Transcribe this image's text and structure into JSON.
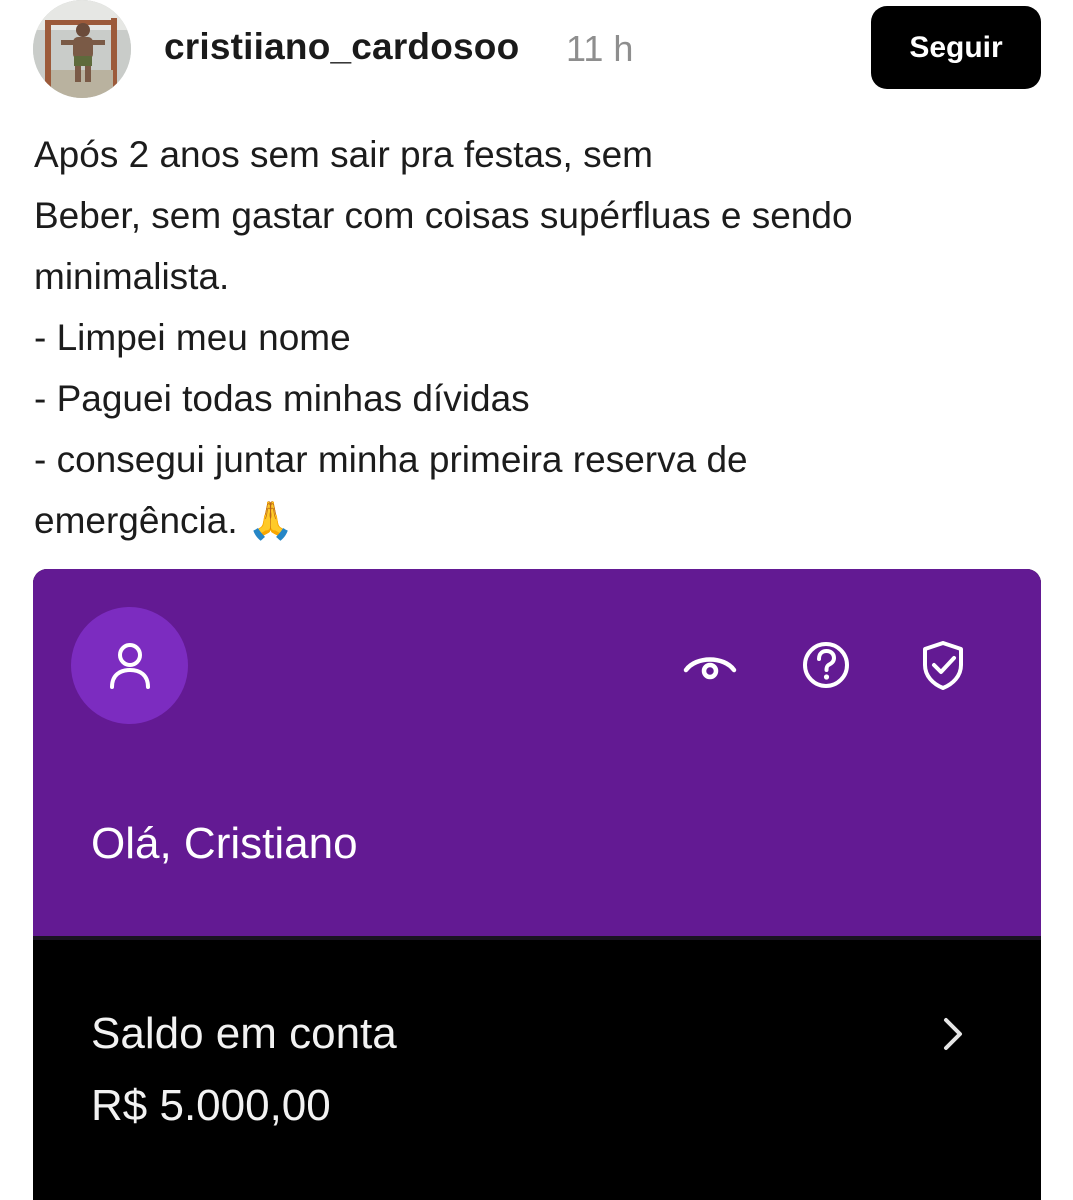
{
  "post": {
    "username": "cristiiano_cardosoo",
    "time": "11 h",
    "follow_label": "Seguir",
    "caption_lines": [
      "Após 2 anos sem sair pra festas, sem",
      "Beber, sem gastar com coisas supérfluas e sendo",
      "minimalista.",
      "- Limpei meu nome",
      "- Paguei todas minhas dívidas",
      "- consegui juntar minha primeira reserva de",
      "emergência. 🙏"
    ]
  },
  "bank_app": {
    "accent_color": "#631a93",
    "greeting": "Olá, Cristiano",
    "icons": [
      "profile-icon",
      "eye-icon",
      "help-icon",
      "shield-check-icon",
      "chevron-right-icon"
    ],
    "balance_label": "Saldo em conta",
    "balance_value": "R$ 5.000,00"
  }
}
